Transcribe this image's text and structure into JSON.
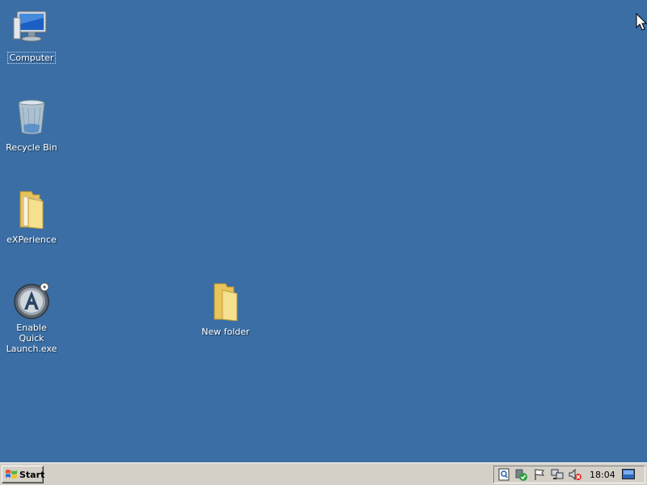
{
  "desktop": {
    "background_color": "#3a6ea5",
    "icons": [
      {
        "label": "Computer",
        "icon": "computer-icon"
      },
      {
        "label": "Recycle Bin",
        "icon": "recycle-bin-icon"
      },
      {
        "label": "eXPerience",
        "icon": "folder-icon"
      },
      {
        "label": "Enable Quick Launch.exe",
        "icon": "application-icon"
      },
      {
        "label": "New folder",
        "icon": "folder-icon"
      }
    ]
  },
  "taskbar": {
    "start_label": "Start",
    "tray_icons": [
      "display-settings-icon",
      "security-shield-icon",
      "action-center-flag-icon",
      "network-icon",
      "volume-muted-icon"
    ],
    "clock": "18:04",
    "show_desktop_icon": "show-desktop-icon"
  }
}
